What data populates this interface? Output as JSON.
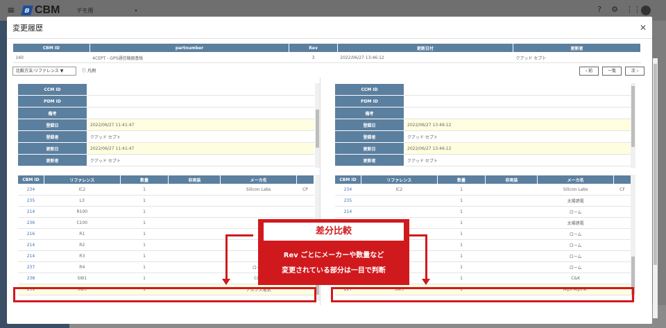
{
  "topbar": {
    "brand": "CBM",
    "tenant": "デモ用"
  },
  "modal": {
    "title": "変更履歴"
  },
  "summary": {
    "headers": [
      "CBM ID",
      "partnumber",
      "Rev",
      "更新日付",
      "更新者"
    ],
    "row": [
      "160",
      "4CEPT - GPS通信機器基板",
      "3",
      "2022/06/27 13:46:12",
      "クアッド セプト"
    ]
  },
  "toolbar": {
    "compare_method": "比較方法:リファレンス ▼",
    "legend": "凡例",
    "prev": "‹ 前",
    "list": "一覧",
    "next": "次 ›"
  },
  "left_info": [
    [
      "CCM ID",
      ""
    ],
    [
      "PDM ID",
      ""
    ],
    [
      "備考",
      ""
    ],
    [
      "登録日",
      "2022/06/27 11:41:47"
    ],
    [
      "登録者",
      "クアッド セプト"
    ],
    [
      "更新日",
      "2022/06/27 11:41:47"
    ],
    [
      "更新者",
      "クアッド セプト"
    ]
  ],
  "right_info": [
    [
      "CCM ID",
      ""
    ],
    [
      "PDM ID",
      ""
    ],
    [
      "備考",
      ""
    ],
    [
      "登録日",
      "2022/06/27 13:46:12"
    ],
    [
      "登録者",
      "クアッド セプト"
    ],
    [
      "更新日",
      "2022/06/27 13:46:12"
    ],
    [
      "更新者",
      "クアッド セプト"
    ]
  ],
  "parts_headers": [
    "CBM ID",
    "リファレンス",
    "数量",
    "非実装",
    "メーカ名",
    ""
  ],
  "left_parts": [
    [
      "234",
      "IC2",
      "1",
      "",
      "Silicon Labs",
      "CP"
    ],
    [
      "235",
      "L3",
      "1",
      "",
      "",
      ""
    ],
    [
      "214",
      "R100",
      "1",
      "",
      "",
      ""
    ],
    [
      "236",
      "C100",
      "1",
      "",
      "",
      ""
    ],
    [
      "216",
      "R1",
      "1",
      "",
      "",
      ""
    ],
    [
      "214",
      "R2",
      "1",
      "",
      "",
      ""
    ],
    [
      "214",
      "R3",
      "1",
      "",
      "",
      ""
    ],
    [
      "237",
      "R4",
      "1",
      "",
      "ローム",
      ""
    ],
    [
      "238",
      "SW1",
      "1",
      "",
      "C&K",
      ""
    ],
    [
      "239",
      "SW3",
      "1",
      "",
      "アルプス電気",
      ""
    ]
  ],
  "right_parts": [
    [
      "234",
      "IC2",
      "1",
      "",
      "Silicon Labs",
      "CF"
    ],
    [
      "235",
      "",
      "1",
      "",
      "太陽誘電",
      ""
    ],
    [
      "214",
      "",
      "1",
      "",
      "ローム",
      ""
    ],
    [
      "236",
      "",
      "1",
      "",
      "太陽誘電",
      ""
    ],
    [
      "216",
      "",
      "1",
      "",
      "ローム",
      ""
    ],
    [
      "214",
      "",
      "1",
      "",
      "ローム",
      ""
    ],
    [
      "214",
      "",
      "1",
      "",
      "ローム",
      ""
    ],
    [
      "237",
      "R4",
      "1",
      "",
      "ローム",
      ""
    ],
    [
      "238",
      "SW1",
      "1",
      "",
      "C&K",
      ""
    ],
    [
      "227",
      "SW3",
      "1",
      "",
      "Alps Alpine.",
      ""
    ]
  ],
  "callout": {
    "title": "差分比較",
    "line1": "Rev ごとにメーカーや数量など",
    "line2": "変更されている部分は一目で判断"
  },
  "colors": {
    "header": "#5b7f9f",
    "highlight": "#fffde0",
    "accent": "#d0191d"
  }
}
